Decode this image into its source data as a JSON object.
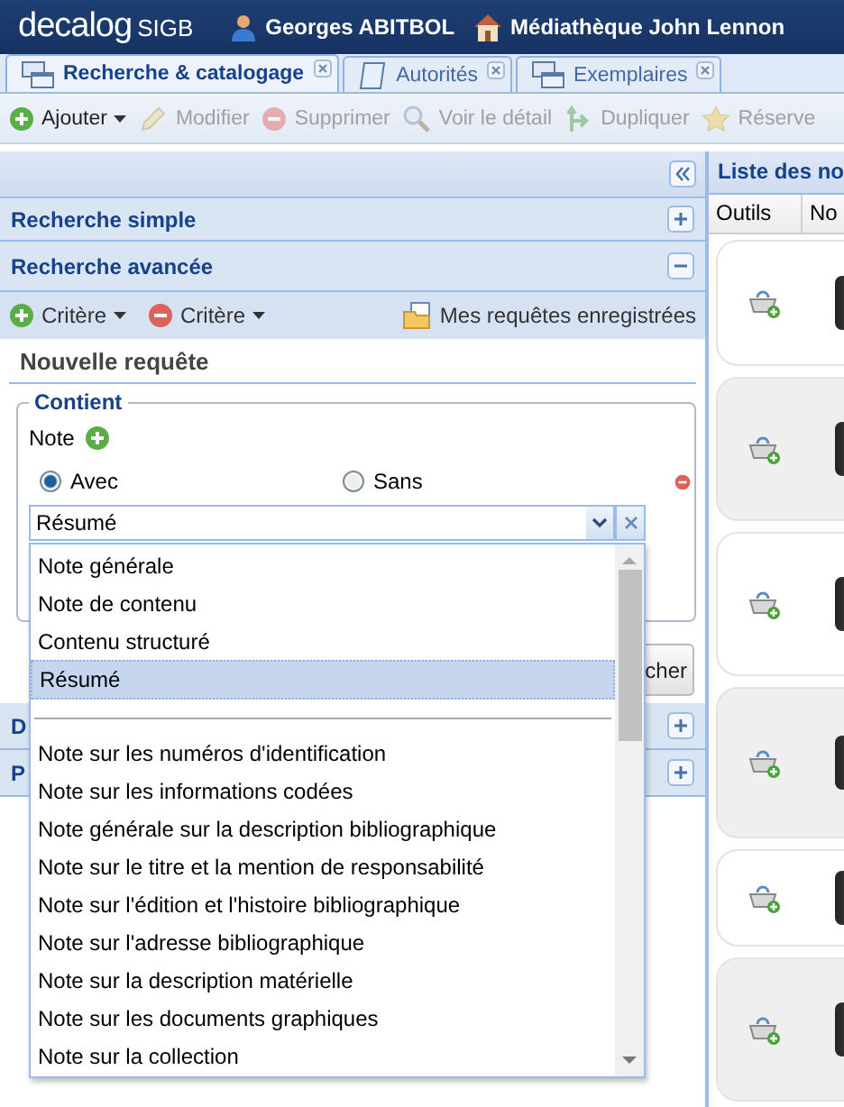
{
  "header": {
    "logo": "decalog",
    "logo_suffix": "SIGB",
    "user": "Georges ABITBOL",
    "library": "Médiathèque John Lennon"
  },
  "tabs": [
    {
      "label": "Recherche & catalogage",
      "kind": "windows",
      "selected": true
    },
    {
      "label": "Autorités",
      "kind": "scroll",
      "selected": false
    },
    {
      "label": "Exemplaires",
      "kind": "windows",
      "selected": false
    }
  ],
  "toolbar": [
    {
      "label": "Ajouter",
      "kind": "add",
      "disabled": false,
      "menu": true
    },
    {
      "label": "Modifier",
      "kind": "pencil",
      "disabled": true,
      "menu": false
    },
    {
      "label": "Supprimer",
      "kind": "remove",
      "disabled": true,
      "menu": false
    },
    {
      "label": "Voir le détail",
      "kind": "search",
      "disabled": true,
      "menu": false
    },
    {
      "label": "Dupliquer",
      "kind": "duplicate",
      "disabled": true,
      "menu": false
    },
    {
      "label": "Réserve",
      "kind": "star",
      "disabled": true,
      "menu": false
    }
  ],
  "search_panel": {
    "sections_top": [
      {
        "title": "Recherche simple",
        "expanded": false
      },
      {
        "title": "Recherche avancée",
        "expanded": true
      }
    ],
    "criteria_toolbar": [
      {
        "label": "Critère",
        "kind": "add"
      },
      {
        "label": "Critère",
        "kind": "remove"
      }
    ],
    "saved_queries": "Mes requêtes enregistrées",
    "query_title": "Nouvelle requête",
    "group": {
      "legend": "Contient",
      "field_label": "Note",
      "radios": [
        {
          "label": "Avec",
          "selected": true
        },
        {
          "label": "Sans",
          "selected": false
        }
      ],
      "value": "Résumé"
    },
    "dropdown": [
      {
        "kind": "option",
        "label": "Note générale",
        "selected": false
      },
      {
        "kind": "option",
        "label": "Note de contenu",
        "selected": false
      },
      {
        "kind": "option",
        "label": "Contenu structuré",
        "selected": false
      },
      {
        "kind": "option",
        "label": "Résumé",
        "selected": true
      },
      {
        "kind": "separator"
      },
      {
        "kind": "option",
        "label": "Note sur les numéros d'identification",
        "selected": false
      },
      {
        "kind": "option",
        "label": "Note sur les informations codées",
        "selected": false
      },
      {
        "kind": "option",
        "label": "Note générale sur la description bibliographique",
        "selected": false
      },
      {
        "kind": "option",
        "label": "Note sur le titre et la mention de responsabilité",
        "selected": false
      },
      {
        "kind": "option",
        "label": "Note sur l'édition et l'histoire bibliographique",
        "selected": false
      },
      {
        "kind": "option",
        "label": "Note sur l'adresse bibliographique",
        "selected": false
      },
      {
        "kind": "option",
        "label": "Note sur la description matérielle",
        "selected": false
      },
      {
        "kind": "option",
        "label": "Note sur les documents graphiques",
        "selected": false
      },
      {
        "kind": "option",
        "label": "Note sur la collection",
        "selected": false
      }
    ],
    "search_button": "cher",
    "sections_bottom": [
      {
        "title": "D",
        "expanded": false
      },
      {
        "title": "P",
        "expanded": false
      }
    ]
  },
  "results_panel": {
    "title": "Liste des no",
    "columns": [
      "Outils",
      "No"
    ],
    "rows": [
      {
        "kind": "record"
      },
      {
        "kind": "record"
      },
      {
        "kind": "record"
      },
      {
        "kind": "record"
      },
      {
        "kind": "record"
      },
      {
        "kind": "record"
      }
    ]
  }
}
